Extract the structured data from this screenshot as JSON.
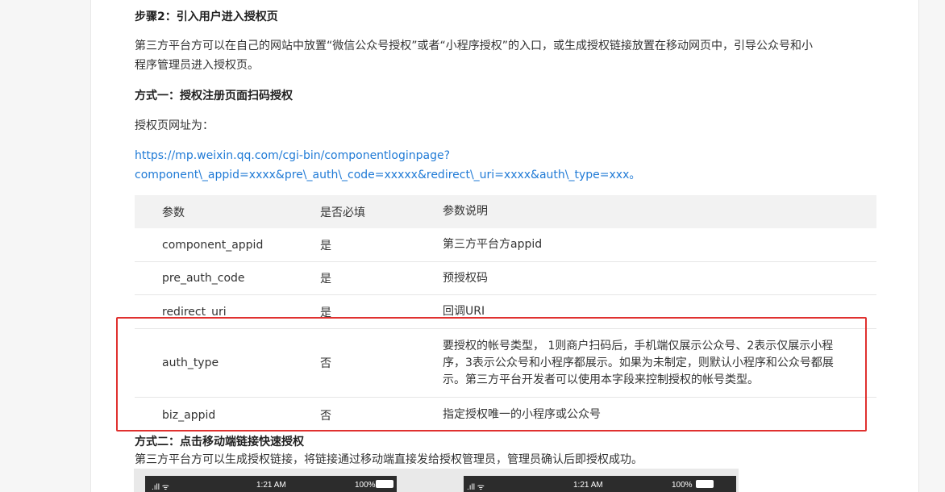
{
  "step2": {
    "title": "步骤2：引入用户进入授权页",
    "desc_line1": "第三方平台方可以在自己的网站中放置“微信公众号授权”或者“小程序授权”的入口，或生成授权链接放置在移动网页中，引导公众号和小",
    "desc_line2": "程序管理员进入授权页。"
  },
  "method1": {
    "title": "方式一：授权注册页面扫码授权",
    "url_label": "授权页网址为：",
    "url_line1": "https://mp.weixin.qq.com/cgi-bin/componentloginpage?",
    "url_line2": "component\\_appid=xxxx&pre\\_auth\\_code=xxxxx&redirect\\_uri=xxxx&auth\\_type=xxx。"
  },
  "table": {
    "headers": [
      "参数",
      "是否必填",
      "参数说明"
    ],
    "rows": [
      {
        "param": "component_appid",
        "required": "是",
        "desc": "第三方平台方appid"
      },
      {
        "param": "pre_auth_code",
        "required": "是",
        "desc": "预授权码"
      },
      {
        "param": "redirect_uri",
        "required": "是",
        "desc": "回调URI"
      },
      {
        "param": "auth_type",
        "required": "否",
        "desc": "要授权的帐号类型， 1则商户扫码后，手机端仅展示公众号、2表示仅展示小程序，3表示公众号和小程序都展示。如果为未制定，则默认小程序和公众号都展示。第三方平台开发者可以使用本字段来控制授权的帐号类型。"
      },
      {
        "param": "biz_appid",
        "required": "否",
        "desc": "指定授权唯一的小程序或公众号"
      }
    ]
  },
  "method2": {
    "title": "方式二：点击移动端链接快速授权",
    "desc": "第三方平台方可以生成授权链接，将链接通过移动端直接发给授权管理员，管理员确认后即授权成功。"
  },
  "phones": [
    {
      "signal": ".ıll ᯤ",
      "time": "1:21 AM",
      "battery": "100%"
    },
    {
      "signal": ".ıll ᯤ",
      "time": "1:21 AM",
      "battery": "100%"
    }
  ]
}
